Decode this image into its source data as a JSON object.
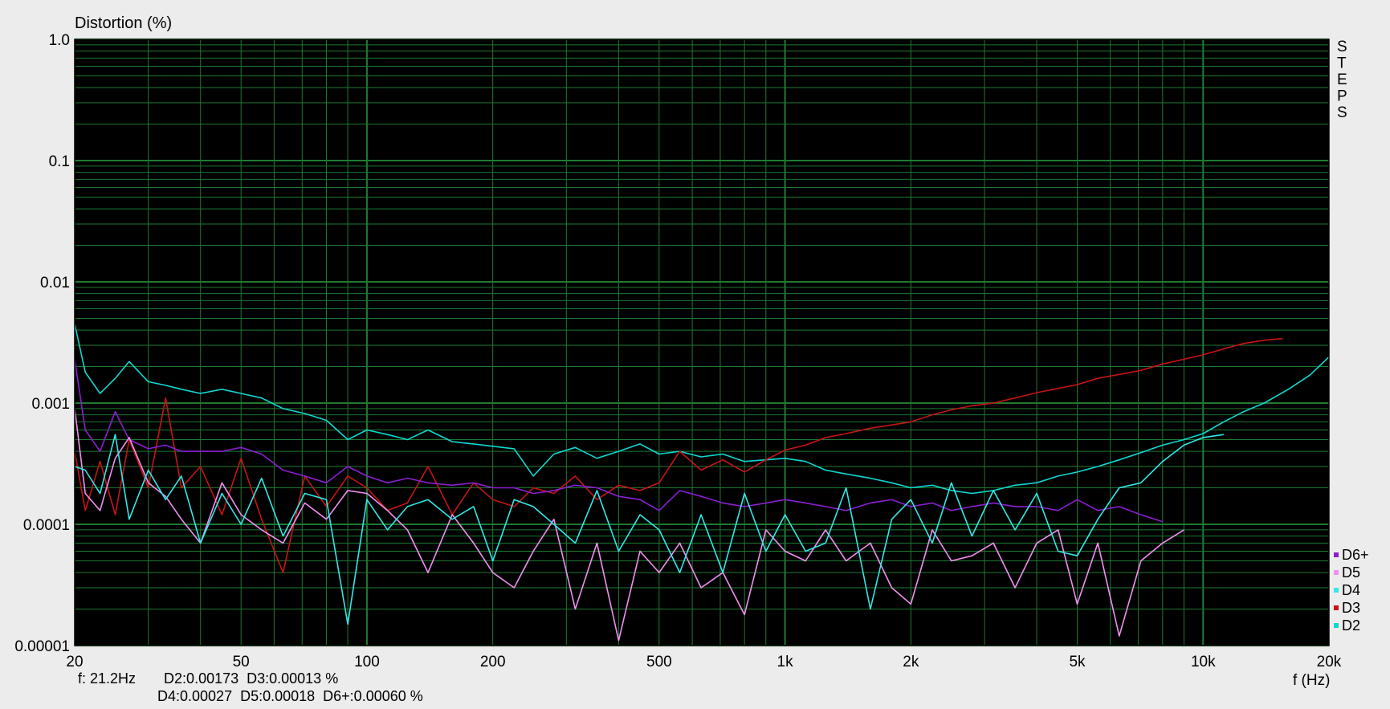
{
  "chart_data": {
    "type": "line",
    "title": "Distortion (%)",
    "ylabel": "Distortion (%)",
    "xlabel": "f (Hz)",
    "xscale": "log",
    "yscale": "log",
    "xlim": [
      20,
      20000
    ],
    "ylim": [
      1e-05,
      1.0
    ],
    "grid": true,
    "legend_position": "bottom-right",
    "side_label": "STEPS",
    "background": "#000000",
    "grid_color": "#1e7a32",
    "x_ticks": [
      {
        "value": 20,
        "label": "20"
      },
      {
        "value": 50,
        "label": "50"
      },
      {
        "value": 100,
        "label": "100"
      },
      {
        "value": 200,
        "label": "200"
      },
      {
        "value": 500,
        "label": "500"
      },
      {
        "value": 1000,
        "label": "1k"
      },
      {
        "value": 2000,
        "label": "2k"
      },
      {
        "value": 5000,
        "label": "5k"
      },
      {
        "value": 10000,
        "label": "10k"
      },
      {
        "value": 20000,
        "label": "20k"
      }
    ],
    "y_ticks": [
      {
        "value": 1.0,
        "label": "1.0"
      },
      {
        "value": 0.1,
        "label": "0.1"
      },
      {
        "value": 0.01,
        "label": "0.01"
      },
      {
        "value": 0.001,
        "label": "0.001"
      },
      {
        "value": 0.0001,
        "label": "0.0001"
      },
      {
        "value": 1e-05,
        "label": "0.00001"
      }
    ],
    "series": [
      {
        "name": "D2",
        "color": "#10d8d0",
        "x": [
          20,
          21.2,
          23,
          25,
          27,
          30,
          33,
          36,
          40,
          45,
          50,
          56,
          63,
          71,
          80,
          90,
          100,
          112,
          125,
          140,
          160,
          180,
          200,
          225,
          250,
          280,
          315,
          355,
          400,
          450,
          500,
          560,
          630,
          710,
          800,
          900,
          1000,
          1120,
          1250,
          1400,
          1600,
          1800,
          2000,
          2250,
          2500,
          2800,
          3150,
          3550,
          4000,
          4500,
          5000,
          5600,
          6300,
          7100,
          8000,
          9000,
          10000,
          11200,
          12500,
          14000,
          16000,
          18000,
          20000
        ],
        "y": [
          0.0045,
          0.0018,
          0.0012,
          0.0016,
          0.0022,
          0.0015,
          0.0014,
          0.0013,
          0.0012,
          0.0013,
          0.0012,
          0.0011,
          0.0009,
          0.00082,
          0.00072,
          0.0005,
          0.0006,
          0.00055,
          0.0005,
          0.0006,
          0.00048,
          0.00046,
          0.00044,
          0.00042,
          0.00025,
          0.00038,
          0.00043,
          0.00035,
          0.0004,
          0.00046,
          0.00038,
          0.0004,
          0.00036,
          0.00038,
          0.00033,
          0.00034,
          0.00035,
          0.00033,
          0.00028,
          0.00026,
          0.00024,
          0.00022,
          0.0002,
          0.00021,
          0.00019,
          0.00018,
          0.00019,
          0.00021,
          0.00022,
          0.00025,
          0.00027,
          0.0003,
          0.00034,
          0.00039,
          0.00045,
          0.0005,
          0.00056,
          0.0007,
          0.00085,
          0.001,
          0.0013,
          0.0017,
          0.0024
        ]
      },
      {
        "name": "D3",
        "color": "#c81414",
        "x": [
          20,
          21.2,
          23,
          25,
          27,
          30,
          33,
          36,
          40,
          45,
          50,
          56,
          63,
          71,
          80,
          90,
          100,
          112,
          125,
          140,
          160,
          180,
          200,
          225,
          250,
          280,
          315,
          355,
          400,
          450,
          500,
          560,
          630,
          710,
          800,
          900,
          1000,
          1120,
          1250,
          1400,
          1600,
          1800,
          2000,
          2250,
          2500,
          2800,
          3150,
          3550,
          4000,
          4500,
          5000,
          5600,
          6300,
          7100,
          8000,
          9000,
          10000,
          11200,
          12500,
          14000,
          15500
        ],
        "y": [
          0.0004,
          0.00013,
          0.00033,
          0.00012,
          0.0005,
          0.0002,
          0.0011,
          0.0002,
          0.0003,
          0.00012,
          0.00035,
          0.00011,
          4e-05,
          0.00025,
          0.00014,
          0.00025,
          0.0002,
          0.00013,
          0.00015,
          0.0003,
          0.00012,
          0.00022,
          0.00016,
          0.00014,
          0.0002,
          0.00018,
          0.00025,
          0.00016,
          0.00021,
          0.00019,
          0.00022,
          0.0004,
          0.00028,
          0.00034,
          0.00027,
          0.00034,
          0.00041,
          0.00045,
          0.00052,
          0.00056,
          0.00062,
          0.00066,
          0.0007,
          0.0008,
          0.00088,
          0.00095,
          0.001,
          0.0011,
          0.00122,
          0.00132,
          0.00142,
          0.0016,
          0.00172,
          0.00186,
          0.0021,
          0.0023,
          0.0025,
          0.0028,
          0.0031,
          0.0033,
          0.0034
        ]
      },
      {
        "name": "D4",
        "color": "#33e8e8",
        "x": [
          20,
          21.2,
          23,
          25,
          27,
          30,
          33,
          36,
          40,
          45,
          50,
          56,
          63,
          71,
          80,
          90,
          100,
          112,
          125,
          140,
          160,
          180,
          200,
          225,
          250,
          280,
          315,
          355,
          400,
          450,
          500,
          560,
          630,
          710,
          800,
          900,
          1000,
          1120,
          1250,
          1400,
          1600,
          1800,
          2000,
          2250,
          2500,
          2800,
          3150,
          3550,
          4000,
          4500,
          5000,
          5600,
          6300,
          7100,
          8000,
          9000,
          10000,
          11200
        ],
        "y": [
          0.0003,
          0.00028,
          0.00018,
          0.00055,
          0.00011,
          0.00028,
          0.00016,
          0.00025,
          7e-05,
          0.00018,
          0.0001,
          0.00024,
          8e-05,
          0.00018,
          0.00016,
          1.5e-05,
          0.00016,
          9e-05,
          0.00014,
          0.00016,
          0.00011,
          0.00014,
          5e-05,
          0.00016,
          0.00014,
          0.0001,
          7e-05,
          0.00019,
          6e-05,
          0.00012,
          9e-05,
          4e-05,
          0.00012,
          4e-05,
          0.00018,
          6e-05,
          0.00012,
          6e-05,
          7e-05,
          0.0002,
          2e-05,
          0.00011,
          0.00016,
          7e-05,
          0.00022,
          8e-05,
          0.00019,
          9e-05,
          0.00018,
          6e-05,
          5.5e-05,
          0.00011,
          0.0002,
          0.00022,
          0.00033,
          0.00045,
          0.00052,
          0.00055
        ]
      },
      {
        "name": "D5",
        "color": "#f090f0",
        "x": [
          20,
          21.2,
          23,
          25,
          27,
          30,
          33,
          36,
          40,
          45,
          50,
          56,
          63,
          71,
          80,
          90,
          100,
          112,
          125,
          140,
          160,
          180,
          200,
          225,
          250,
          280,
          315,
          355,
          400,
          450,
          500,
          560,
          630,
          710,
          800,
          900,
          1000,
          1120,
          1250,
          1400,
          1600,
          1800,
          2000,
          2250,
          2500,
          2800,
          3150,
          3550,
          4000,
          4500,
          5000,
          5600,
          6300,
          7100,
          8000,
          9000
        ],
        "y": [
          0.0009,
          0.00018,
          0.00013,
          0.00035,
          0.00052,
          0.00022,
          0.00017,
          0.00011,
          7e-05,
          0.00022,
          0.00012,
          9e-05,
          7e-05,
          0.00015,
          0.00011,
          0.00019,
          0.00018,
          0.00013,
          9e-05,
          4e-05,
          0.00012,
          7e-05,
          4e-05,
          3e-05,
          6e-05,
          0.00011,
          2e-05,
          7e-05,
          1.1e-05,
          6e-05,
          4e-05,
          7e-05,
          3e-05,
          4e-05,
          1.8e-05,
          9e-05,
          6e-05,
          5e-05,
          9e-05,
          5e-05,
          7e-05,
          3e-05,
          2.2e-05,
          9e-05,
          5e-05,
          5.5e-05,
          7e-05,
          3e-05,
          7e-05,
          9e-05,
          2.2e-05,
          7e-05,
          1.2e-05,
          5e-05,
          7e-05,
          9e-05
        ]
      },
      {
        "name": "D6+",
        "color": "#8a1fd0",
        "x": [
          20,
          21.2,
          23,
          25,
          27,
          30,
          33,
          36,
          40,
          45,
          50,
          56,
          63,
          71,
          80,
          90,
          100,
          112,
          125,
          140,
          160,
          180,
          200,
          225,
          250,
          280,
          315,
          355,
          400,
          450,
          500,
          560,
          630,
          710,
          800,
          900,
          1000,
          1120,
          1250,
          1400,
          1600,
          1800,
          2000,
          2250,
          2500,
          2800,
          3150,
          3550,
          4000,
          4500,
          5000,
          5600,
          6300,
          7100,
          8000
        ],
        "y": [
          0.0023,
          0.0006,
          0.0004,
          0.00085,
          0.0005,
          0.00042,
          0.00045,
          0.0004,
          0.0004,
          0.0004,
          0.00043,
          0.00038,
          0.00028,
          0.00025,
          0.00022,
          0.0003,
          0.00025,
          0.00022,
          0.00024,
          0.00022,
          0.00021,
          0.00022,
          0.0002,
          0.0002,
          0.00018,
          0.00019,
          0.00021,
          0.0002,
          0.00017,
          0.00016,
          0.00013,
          0.00019,
          0.00017,
          0.00015,
          0.00014,
          0.00015,
          0.00016,
          0.00015,
          0.00014,
          0.00013,
          0.00015,
          0.00016,
          0.00014,
          0.00015,
          0.00013,
          0.00014,
          0.00015,
          0.00014,
          0.00014,
          0.00013,
          0.00016,
          0.00013,
          0.00014,
          0.00012,
          0.000105
        ]
      }
    ],
    "legend_order": [
      "D6+",
      "D5",
      "D4",
      "D3",
      "D2"
    ]
  },
  "readout": {
    "line1": "f: 21.2Hz       D2:0.00173  D3:0.00013 %",
    "line2": "D4:0.00027  D5:0.00018  D6+:0.00060 %"
  }
}
